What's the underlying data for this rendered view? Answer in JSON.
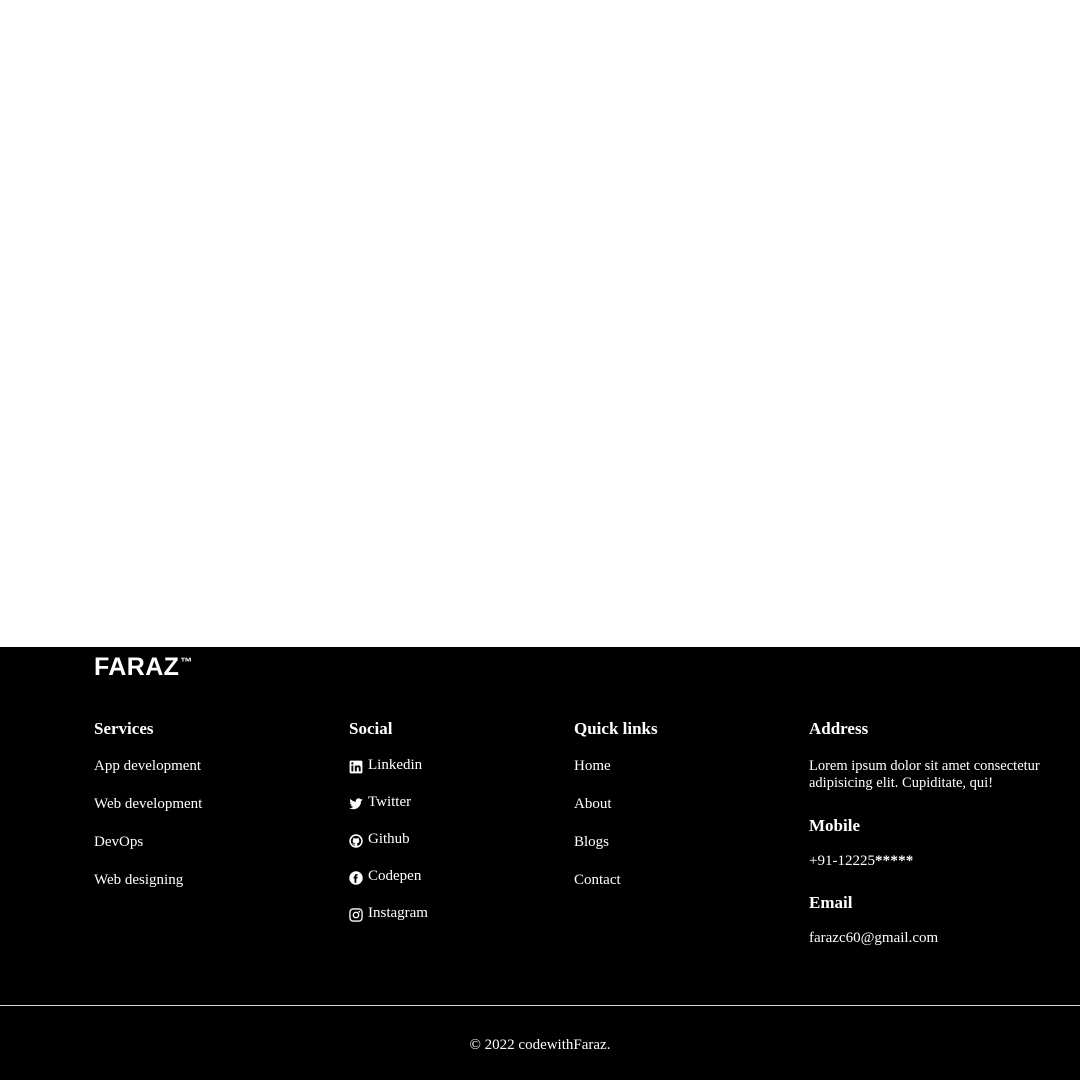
{
  "page": {
    "background_top": "#ffffff",
    "footer_background": "#000000",
    "text_color": "#ffffff",
    "divider_color": "#d9d9d9"
  },
  "footer": {
    "brand": {
      "name": "FARAZ",
      "trademark": "™"
    },
    "columns": {
      "services": {
        "heading": "Services",
        "items": [
          {
            "label": "App development"
          },
          {
            "label": "Web development"
          },
          {
            "label": "DevOps"
          },
          {
            "label": "Web designing"
          }
        ]
      },
      "social": {
        "heading": "Social",
        "items": [
          {
            "label": "Linkedin",
            "icon": "linkedin-icon"
          },
          {
            "label": "Twitter",
            "icon": "twitter-icon"
          },
          {
            "label": "Github",
            "icon": "github-icon"
          },
          {
            "label": "Codepen",
            "icon": "facebook-icon"
          },
          {
            "label": "Instagram",
            "icon": "instagram-icon"
          }
        ]
      },
      "quick_links": {
        "heading": "Quick links",
        "items": [
          {
            "label": "Home"
          },
          {
            "label": "About"
          },
          {
            "label": "Blogs"
          },
          {
            "label": "Contact"
          }
        ]
      },
      "address": {
        "heading": "Address",
        "text": "Lorem ipsum dolor sit amet consectetur adipisicing elit. Cupiditate, qui!",
        "mobile_heading": "Mobile",
        "mobile_value": "+91-12225",
        "mobile_masked": "*****",
        "email_heading": "Email",
        "email_value": "farazc60@gmail.com"
      }
    },
    "copyright": "© 2022 codewithFaraz."
  }
}
